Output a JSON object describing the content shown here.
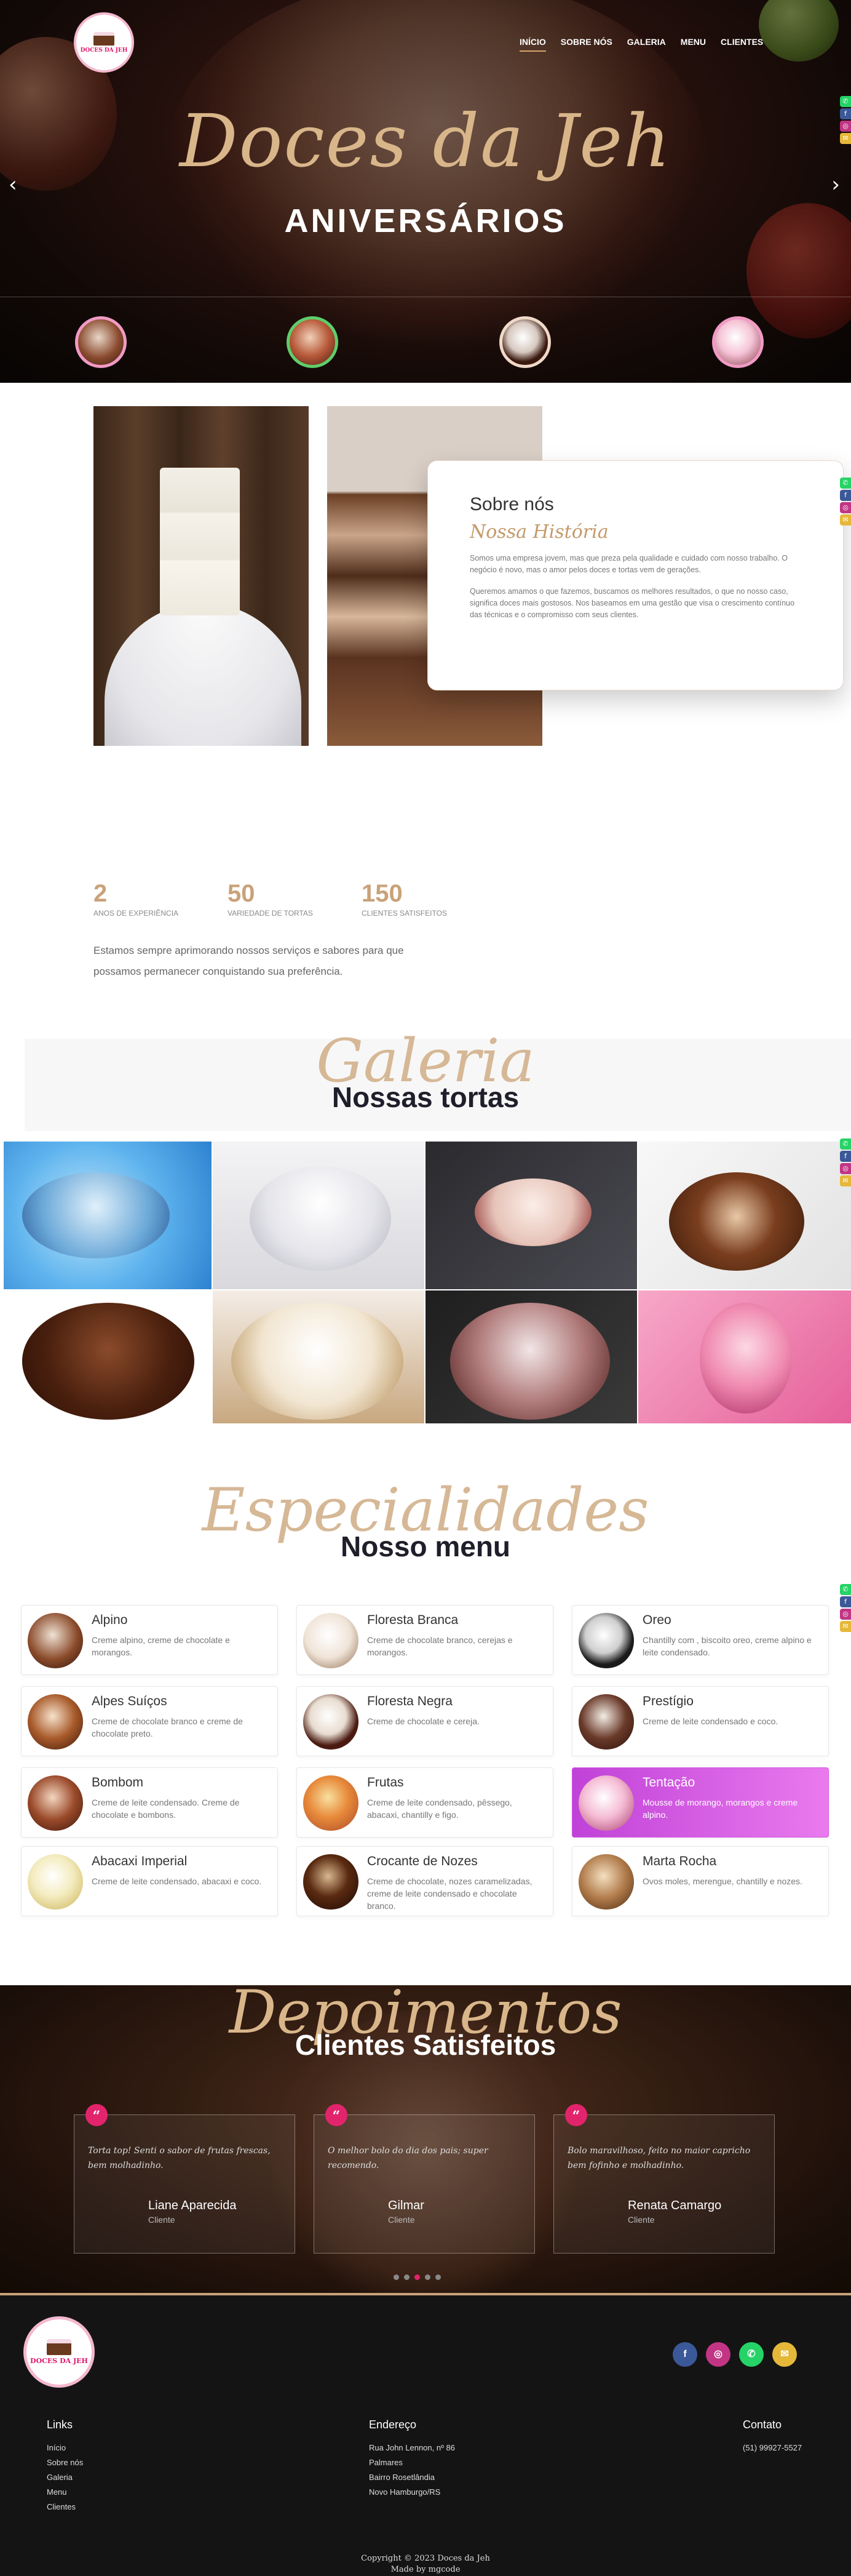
{
  "brand": {
    "logo_text": "DOCES DA JEH",
    "accent": "#c9a27a",
    "pink": "#e2246c"
  },
  "nav": {
    "items": [
      "INÍCIO",
      "SOBRE NÓS",
      "GALERIA",
      "MENU",
      "CLIENTES"
    ],
    "active": "INÍCIO"
  },
  "hero": {
    "script": "Doces da Jeh",
    "title": "ANIVERSÁRIOS",
    "prev_icon": "chevron-left-icon",
    "next_icon": "chevron-right-icon"
  },
  "side_social": [
    "whatsapp-icon",
    "facebook-icon",
    "instagram-icon",
    "email-icon"
  ],
  "about": {
    "heading": "Sobre nós",
    "script": "Nossa História",
    "p1": "Somos uma empresa jovem, mas que preza pela qualidade e cuidado com nosso trabalho. O negócio é novo, mas o amor pelos doces e tortas vem de gerações.",
    "p2": "Queremos amamos o que fazemos, buscamos os melhores resultados, o que no nosso caso, significa doces mais gostosos. Nos baseamos em uma gestão que visa o crescimento contínuo das técnicas e o compromisso com seus clientes."
  },
  "stats": {
    "items": [
      {
        "value": "2",
        "label": "ANOS DE EXPERIÊNCIA"
      },
      {
        "value": "50",
        "label": "VARIEDADE DE TORTAS"
      },
      {
        "value": "150",
        "label": "CLIENTES SATISFEITOS"
      }
    ],
    "text": "Estamos sempre aprimorando nossos serviços e sabores para que possamos permanecer conquistando sua preferência."
  },
  "gallery": {
    "script": "Galeria",
    "title": "Nossas tortas"
  },
  "menu": {
    "script": "Especialidades",
    "title": "Nosso menu",
    "items": [
      {
        "name": "Alpino",
        "desc": "Creme alpino, creme de chocolate e morangos."
      },
      {
        "name": "Floresta Branca",
        "desc": "Creme de chocolate branco, cerejas e morangos."
      },
      {
        "name": "Oreo",
        "desc": "Chantilly com , biscoito oreo, creme alpino e leite condensado."
      },
      {
        "name": "Alpes Suíços",
        "desc": "Creme de chocolate branco e creme de chocolate preto."
      },
      {
        "name": "Floresta Negra",
        "desc": "Creme de chocolate e cereja."
      },
      {
        "name": "Prestígio",
        "desc": "Creme de leite condensado e coco."
      },
      {
        "name": "Bombom",
        "desc": "Creme de leite condensado. Creme de chocolate e bombons."
      },
      {
        "name": "Frutas",
        "desc": "Creme de leite condensado, pêssego, abacaxi, chantilly e figo."
      },
      {
        "name": "Tentação",
        "desc": "Mousse de morango, morangos e creme alpino."
      },
      {
        "name": "Abacaxi Imperial",
        "desc": "Creme de leite condensado, abacaxi e coco."
      },
      {
        "name": "Crocante de Nozes",
        "desc": "Creme de chocolate, nozes caramelizadas, creme de leite condensado e chocolate branco."
      },
      {
        "name": "Marta Rocha",
        "desc": "Ovos moles, merengue, chantilly e nozes."
      }
    ]
  },
  "testimonials": {
    "script": "Depoimentos",
    "title": "Clientes Satisfeitos",
    "items": [
      {
        "text": "Torta top! Senti o sabor de frutas frescas, bem molhadinho.",
        "name": "Liane Aparecida",
        "role": "Cliente"
      },
      {
        "text": "O melhor bolo do dia dos pais; super recomendo.",
        "name": "Gilmar",
        "role": "Cliente"
      },
      {
        "text": "Bolo maravilhoso, feito no maior capricho bem fofinho e molhadinho.",
        "name": "Renata Camargo",
        "role": "Cliente"
      }
    ]
  },
  "footer": {
    "links_title": "Links",
    "links": [
      "Início",
      "Sobre nós",
      "Galeria",
      "Menu",
      "Clientes"
    ],
    "address_title": "Endereço",
    "address": [
      "Rua John Lennon, nº 86",
      "Palmares",
      "Bairro Rosetlândia",
      "Novo Hamburgo/RS"
    ],
    "contact_title": "Contato",
    "phone": "(51) 99927-5527",
    "copyright": "Copyright © 2023 Doces da Jeh",
    "made_by": "Made by mgcode",
    "social": [
      "facebook-icon",
      "instagram-icon",
      "whatsapp-icon",
      "email-icon"
    ]
  }
}
